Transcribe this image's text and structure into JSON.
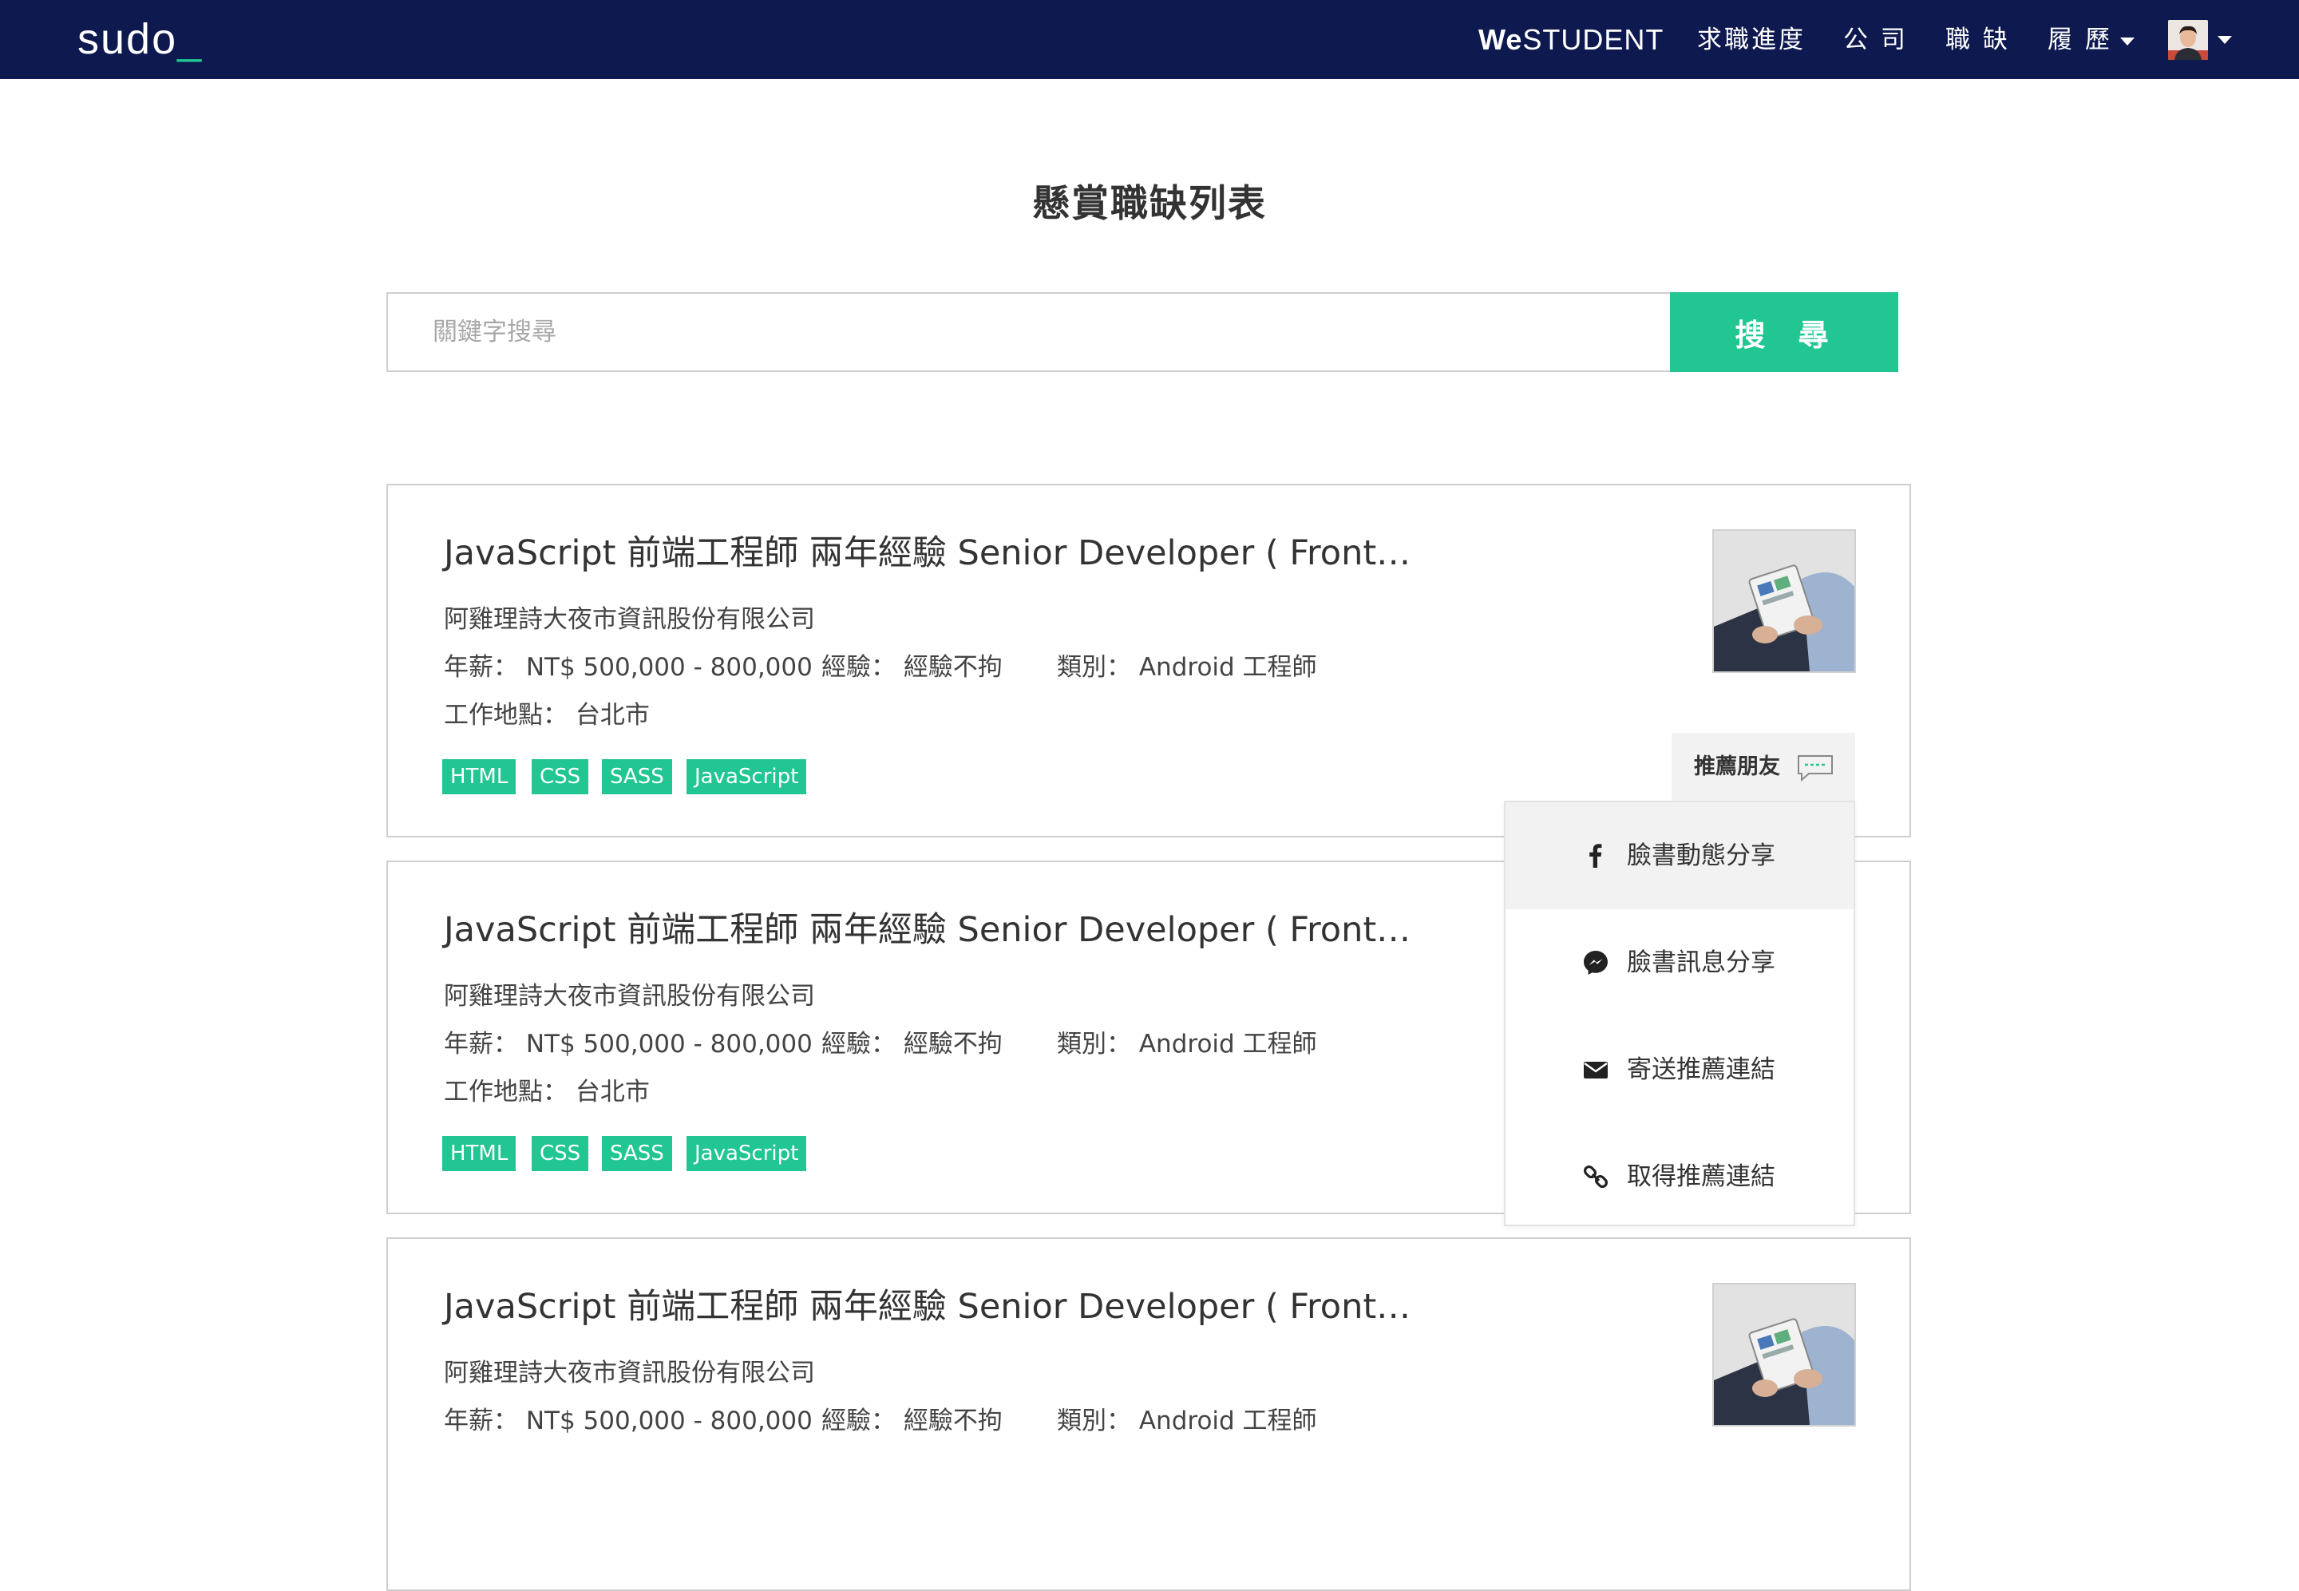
{
  "navbar": {
    "logo": "sudo",
    "logo_cursor": "_",
    "brand_we": "We",
    "brand_rest": "STUDENT",
    "items": [
      "求職進度",
      "公 司",
      "職 缺",
      "履 歷"
    ]
  },
  "page": {
    "title": "懸賞職缺列表"
  },
  "search": {
    "placeholder": "關鍵字搜尋",
    "button_label": "搜 尋"
  },
  "jobs": [
    {
      "title": "JavaScript 前端工程師 兩年經驗 Senior Developer ( Front…",
      "company": "阿雞理詩大夜市資訊股份有限公司",
      "salary": "年薪： NT$ 500,000 - 800,000",
      "experience": "經驗： 經驗不拘",
      "category": "類別： Android 工程師",
      "location": "工作地點： 台北市",
      "tags": [
        "HTML",
        "CSS",
        "SASS",
        "JavaScript"
      ]
    },
    {
      "title": "JavaScript 前端工程師 兩年經驗 Senior Developer ( Front…",
      "company": "阿雞理詩大夜市資訊股份有限公司",
      "salary": "年薪： NT$ 500,000 - 800,000",
      "experience": "經驗： 經驗不拘",
      "category": "類別： Android 工程師",
      "location": "工作地點： 台北市",
      "tags": [
        "HTML",
        "CSS",
        "SASS",
        "JavaScript"
      ]
    },
    {
      "title": "JavaScript 前端工程師 兩年經驗 Senior Developer ( Front…",
      "company": "阿雞理詩大夜市資訊股份有限公司",
      "salary": "年薪： NT$ 500,000 - 800,000",
      "experience": "經驗： 經驗不拘",
      "category": "類別： Android 工程師"
    }
  ],
  "recommend": {
    "label": "推薦朋友",
    "icon": "chat-bubble-icon",
    "menu": [
      {
        "label": "臉書動態分享",
        "icon": "facebook-icon"
      },
      {
        "label": "臉書訊息分享",
        "icon": "messenger-icon"
      },
      {
        "label": "寄送推薦連結",
        "icon": "envelope-icon"
      },
      {
        "label": "取得推薦連結",
        "icon": "link-icon"
      }
    ]
  },
  "colors": {
    "navbar": "#0e1a4f",
    "accent": "#21c693"
  }
}
